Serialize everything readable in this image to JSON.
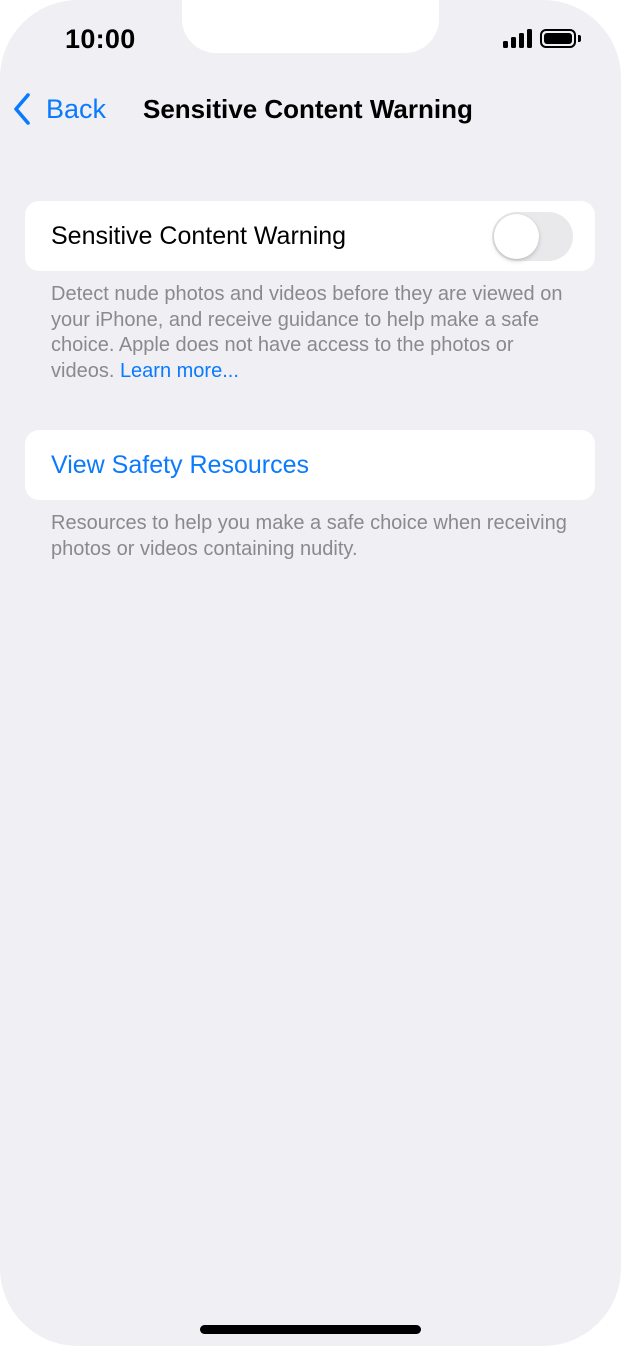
{
  "status_bar": {
    "time": "10:00",
    "signal_icon": "cellular-signal-icon",
    "battery_icon": "battery-full-icon"
  },
  "nav": {
    "back_label": "Back",
    "back_icon": "chevron-left-icon",
    "title": "Sensitive Content Warning"
  },
  "settings": {
    "toggle_row": {
      "label": "Sensitive Content Warning",
      "toggle_on": false,
      "footer_text": "Detect nude photos and videos before they are viewed on your iPhone, and receive guidance to help make a safe choice. Apple does not have access to the photos or videos.",
      "footer_link": "Learn more..."
    },
    "resources_row": {
      "label": "View Safety Resources",
      "footer_text": "Resources to help you make a safe choice when receiving photos or videos containing nudity."
    }
  },
  "colors": {
    "accent": "#0a7aff",
    "background": "#efeff4",
    "cell": "#ffffff",
    "footer_text": "#8a8a8e",
    "toggle_off": "#e9e9eb"
  }
}
